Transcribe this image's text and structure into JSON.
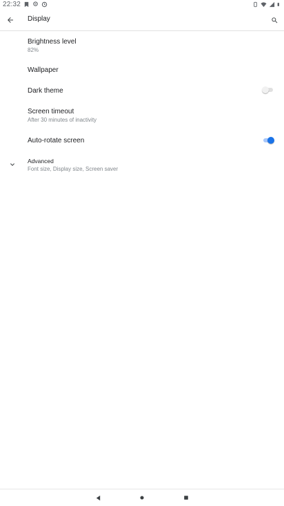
{
  "status_bar": {
    "time": "22:32"
  },
  "app_bar": {
    "title": "Display",
    "back_icon": "arrow-back-icon",
    "search_icon": "search-icon"
  },
  "settings": {
    "brightness": {
      "title": "Brightness level",
      "subtitle": "82%"
    },
    "wallpaper": {
      "title": "Wallpaper"
    },
    "dark_theme": {
      "title": "Dark theme",
      "enabled": false
    },
    "screen_timeout": {
      "title": "Screen timeout",
      "subtitle": "After 30 minutes of inactivity"
    },
    "auto_rotate": {
      "title": "Auto-rotate screen",
      "enabled": true
    },
    "advanced": {
      "title": "Advanced",
      "subtitle": "Font size, Display size, Screen saver"
    }
  },
  "colors": {
    "accent": "#1a73e8",
    "text_primary": "#202124",
    "text_secondary": "#80868b"
  }
}
